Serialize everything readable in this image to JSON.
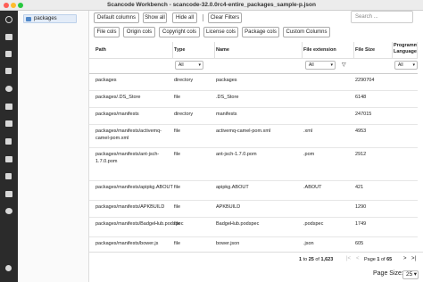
{
  "window": {
    "title": "Scancode Workbench - scancode-32.0.0rc4-entire_packages_sample-p.json"
  },
  "tree": {
    "root_label": "packages"
  },
  "toolbar": {
    "default_columns": "Default columns",
    "show_all": "Show all",
    "hide_all": "Hide all",
    "clear_filters": "Clear Filters",
    "file_cols": "File cols",
    "origin_cols": "Origin cols",
    "copyright_cols": "Copyright cols",
    "license_cols": "License cols",
    "package_cols": "Package cols",
    "custom_columns": "Custom Columns"
  },
  "search": {
    "placeholder": "Search ..."
  },
  "table": {
    "headers": {
      "path": "Path",
      "type": "Type",
      "name": "Name",
      "ext": "File extension",
      "size": "File Size",
      "lang": "Programm Language"
    },
    "filter_all": "All",
    "rows": [
      {
        "path": "packages",
        "type": "directory",
        "name": "packages",
        "ext": "",
        "size": "2290704"
      },
      {
        "path": "packages/.DS_Store",
        "type": "file",
        "name": ".DS_Store",
        "ext": "",
        "size": "6148"
      },
      {
        "path": "packages/manifests",
        "type": "directory",
        "name": "manifests",
        "ext": "",
        "size": "247015"
      },
      {
        "path": "packages/manifests/activemq-camel-pom.xml",
        "type": "file",
        "name": "activemq-camel-pom.xml",
        "ext": ".xml",
        "size": "4953"
      },
      {
        "path": "packages/manifests/ant-jsch-1.7.0.pom",
        "type": "file",
        "name": "ant-jsch-1.7.0.pom",
        "ext": ".pom",
        "size": "2912"
      },
      {
        "path": "packages/manifests/apipkg.ABOUT",
        "type": "file",
        "name": "apipkg.ABOUT",
        "ext": ".ABOUT",
        "size": "421"
      },
      {
        "path": "packages/manifests/APKBUILD",
        "type": "file",
        "name": "APKBUILD",
        "ext": "",
        "size": "1290"
      },
      {
        "path": "packages/manifests/BadgeHub.podspec",
        "type": "file",
        "name": "BadgeHub.podspec",
        "ext": ".podspec",
        "size": "1749"
      },
      {
        "path": "packages/manifests/bower.js",
        "type": "file",
        "name": "bower.json",
        "ext": ".json",
        "size": "605"
      }
    ]
  },
  "pagination": {
    "range_start": "1",
    "range_to": "to",
    "range_end": "25",
    "range_of": "of",
    "total": "1,623",
    "page_label": "Page",
    "page_num": "1",
    "page_of": "of",
    "page_total": "65"
  },
  "page_size": {
    "label": "Page Size:",
    "value": "25"
  }
}
